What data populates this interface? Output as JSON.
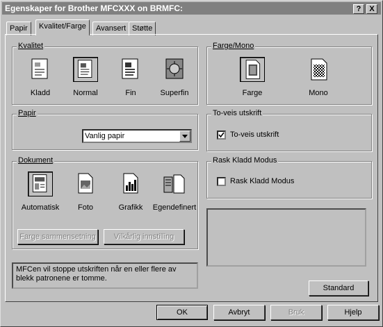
{
  "title": "Egenskaper for Brother MFCXXX on BRMFC:",
  "title_buttons": {
    "help": "?",
    "close": "X"
  },
  "tabs": [
    {
      "label": "Papir",
      "active": false
    },
    {
      "label": "Kvalitet/Farge",
      "active": true
    },
    {
      "label": "Avansert",
      "active": false
    },
    {
      "label": "Støtte",
      "active": false
    }
  ],
  "quality": {
    "label": "Kvalitet",
    "selected": "Normal",
    "items": [
      {
        "label": "Kladd",
        "icon": "draft-quality-icon"
      },
      {
        "label": "Normal",
        "icon": "normal-quality-icon"
      },
      {
        "label": "Fin",
        "icon": "fine-quality-icon"
      },
      {
        "label": "Superfin",
        "icon": "superfine-quality-icon"
      }
    ]
  },
  "color_mono": {
    "label": "Farge/Mono",
    "selected": "Farge",
    "items": [
      {
        "label": "Farge",
        "icon": "color-page-icon"
      },
      {
        "label": "Mono",
        "icon": "mono-page-icon"
      }
    ]
  },
  "paper": {
    "label": "Papir",
    "value": "Vanlig papir"
  },
  "bidirectional": {
    "label": "To-veis utskrift",
    "checkbox_label": "To-veis utskrift",
    "checked": true
  },
  "fast_draft": {
    "label": "Rask Kladd Modus",
    "checkbox_label": "Rask Kladd Modus",
    "checked": false
  },
  "document": {
    "label": "Dokument",
    "selected": "Automatisk",
    "items": [
      {
        "label": "Automatisk",
        "icon": "automatic-document-icon"
      },
      {
        "label": "Foto",
        "icon": "photo-document-icon"
      },
      {
        "label": "Grafikk",
        "icon": "graphics-document-icon"
      },
      {
        "label": "Egendefinert",
        "icon": "custom-document-icon"
      }
    ],
    "buttons": {
      "color_matching": "Farge sammensetning",
      "custom_settings": "Vilkårlig innstilling"
    }
  },
  "status_message": "MFCen vil stoppe utskriften når en eller flere av blekk patronene er tomme.",
  "standard_button": "Standard",
  "footer": {
    "ok": "OK",
    "cancel": "Avbryt",
    "apply": "Bruk",
    "help": "Hjelp"
  }
}
